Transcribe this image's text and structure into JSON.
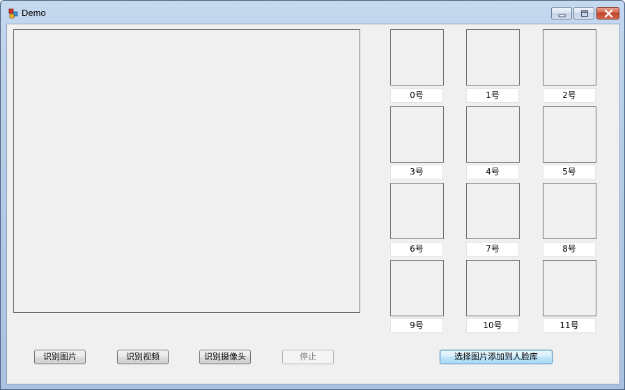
{
  "window": {
    "title": "Demo",
    "icon": "app-blocks-icon",
    "controls": {
      "minimize": "minimize-icon",
      "maximize": "maximize-icon",
      "close": "close-icon"
    }
  },
  "faces": {
    "labels": [
      "0号",
      "1号",
      "2号",
      "3号",
      "4号",
      "5号",
      "6号",
      "7号",
      "8号",
      "9号",
      "10号",
      "11号"
    ]
  },
  "buttons": {
    "recognize_image": "识别图片",
    "recognize_video": "识别视频",
    "recognize_camera": "识别摄像头",
    "stop": "停止",
    "add_to_face_library": "选择图片添加到人脸库"
  },
  "colors": {
    "title_bar": "#b6cde6",
    "client_background": "#f0f0f0",
    "close_button": "#c9452f"
  }
}
